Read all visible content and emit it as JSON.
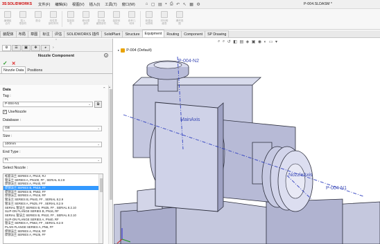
{
  "app": {
    "brand_ds": "3S",
    "brand_name": "SOLIDWORKS",
    "menu": [
      "文件(F)",
      "编辑(E)",
      "视图(V)",
      "插入(I)",
      "工具(T)",
      "窗口(W)"
    ],
    "document_title": "P-004.SLDASM *"
  },
  "ribbon": {
    "buttons": [
      {
        "label": "编辑组\n合件",
        "icon": "edit-component-icon"
      },
      {
        "label": "插入\n零部件",
        "icon": "insert-component-icon"
      },
      {
        "label": "配合",
        "icon": "mate-icon"
      },
      {
        "label": "线性零\n部件阵列",
        "icon": "linear-pattern-icon"
      },
      {
        "label": "智能扣\n件",
        "icon": "smart-fasteners-icon"
      },
      {
        "label": "移动零\n部件",
        "icon": "move-component-icon"
      },
      {
        "label": "显示隐\n藏零部件",
        "icon": "show-hidden-icon"
      },
      {
        "label": "装配体\n特征",
        "icon": "assembly-features-icon"
      },
      {
        "label": "参考几\n何体",
        "icon": "reference-geometry-icon"
      },
      {
        "label": "新建运\n动算例",
        "icon": "motion-study-icon"
      },
      {
        "label": "材料明\n细表",
        "icon": "bom-icon"
      },
      {
        "label": "爆炸视\n图",
        "icon": "exploded-view-icon"
      }
    ]
  },
  "command_tabs": [
    "装配体",
    "布局",
    "草图",
    "标注",
    "评估",
    "SOLIDWORKS 插件",
    "SolidPlant",
    "Structure",
    "Equipment",
    "Routing",
    "Component",
    "SP Drawing"
  ],
  "active_command_tab": "Equipment",
  "property_manager": {
    "title": "Nozzle Component",
    "subtabs": [
      "Nozzle Data",
      "Positions"
    ],
    "active_subtab": "Nozzle Data",
    "section_data": "Data",
    "tag_label": "Tag :",
    "tag_value": "P-004-N1",
    "use_nozzle_label": "UseNozzle",
    "use_nozzle_checked": true,
    "database_label": "Database :",
    "database_value": "GB",
    "size_label": "Size :",
    "size_value": "100mm",
    "end_type_label": "End Type :",
    "end_type_value": "FL",
    "select_nozzle_label": "Select Nozzle :",
    "nozzle_list": [
      "松套法兰 SERIES A, PN10, RJ",
      "管法兰 SERIES A, PN100, FF , SERIAL 8.2.9",
      "焊颈法兰 SERIES A, PN40, FF",
      "焊颈法兰 SERIES B, PN16, FF",
      "焊颈法兰 SERIES B, PN63, FF",
      "焊颈法兰 SERIES A, PN16, RF",
      "管法兰 SERIES B, PN40, FF , SERIAL 8.2.9",
      "管法兰 SERIES A, PN25, FF , SERIAL 8.2.9",
      "SERIAL 管法兰 SERIES B, PN25, FF , SERIAL 8.2.10",
      "SLIP-ON FLANGE SERIES B, PN16, RF",
      "SERIAL 管法兰 SERIES B, PN10, FF , SERIAL 8.2.10",
      "SLIP-ON FLANGE SERIES A, PN40, RF",
      "管法兰 SERIES A, PN63, FF , SERIAL 8.2.9",
      "PLAIN FLANGE SERIES A, PN6, FF",
      "焊颈法兰 SERIES A, PN16, RF",
      "焊颈法兰 SERIES A, PN25, FF"
    ],
    "selected_nozzle_index": 3
  },
  "graphics": {
    "tree_root": "P-004  (Default)",
    "labels": {
      "top_nozzle": "P-004-N2",
      "main_axis": "MainAxis",
      "nozzle_axis": "NozzleAxis",
      "front_nozzle": "P-004-N1"
    }
  }
}
